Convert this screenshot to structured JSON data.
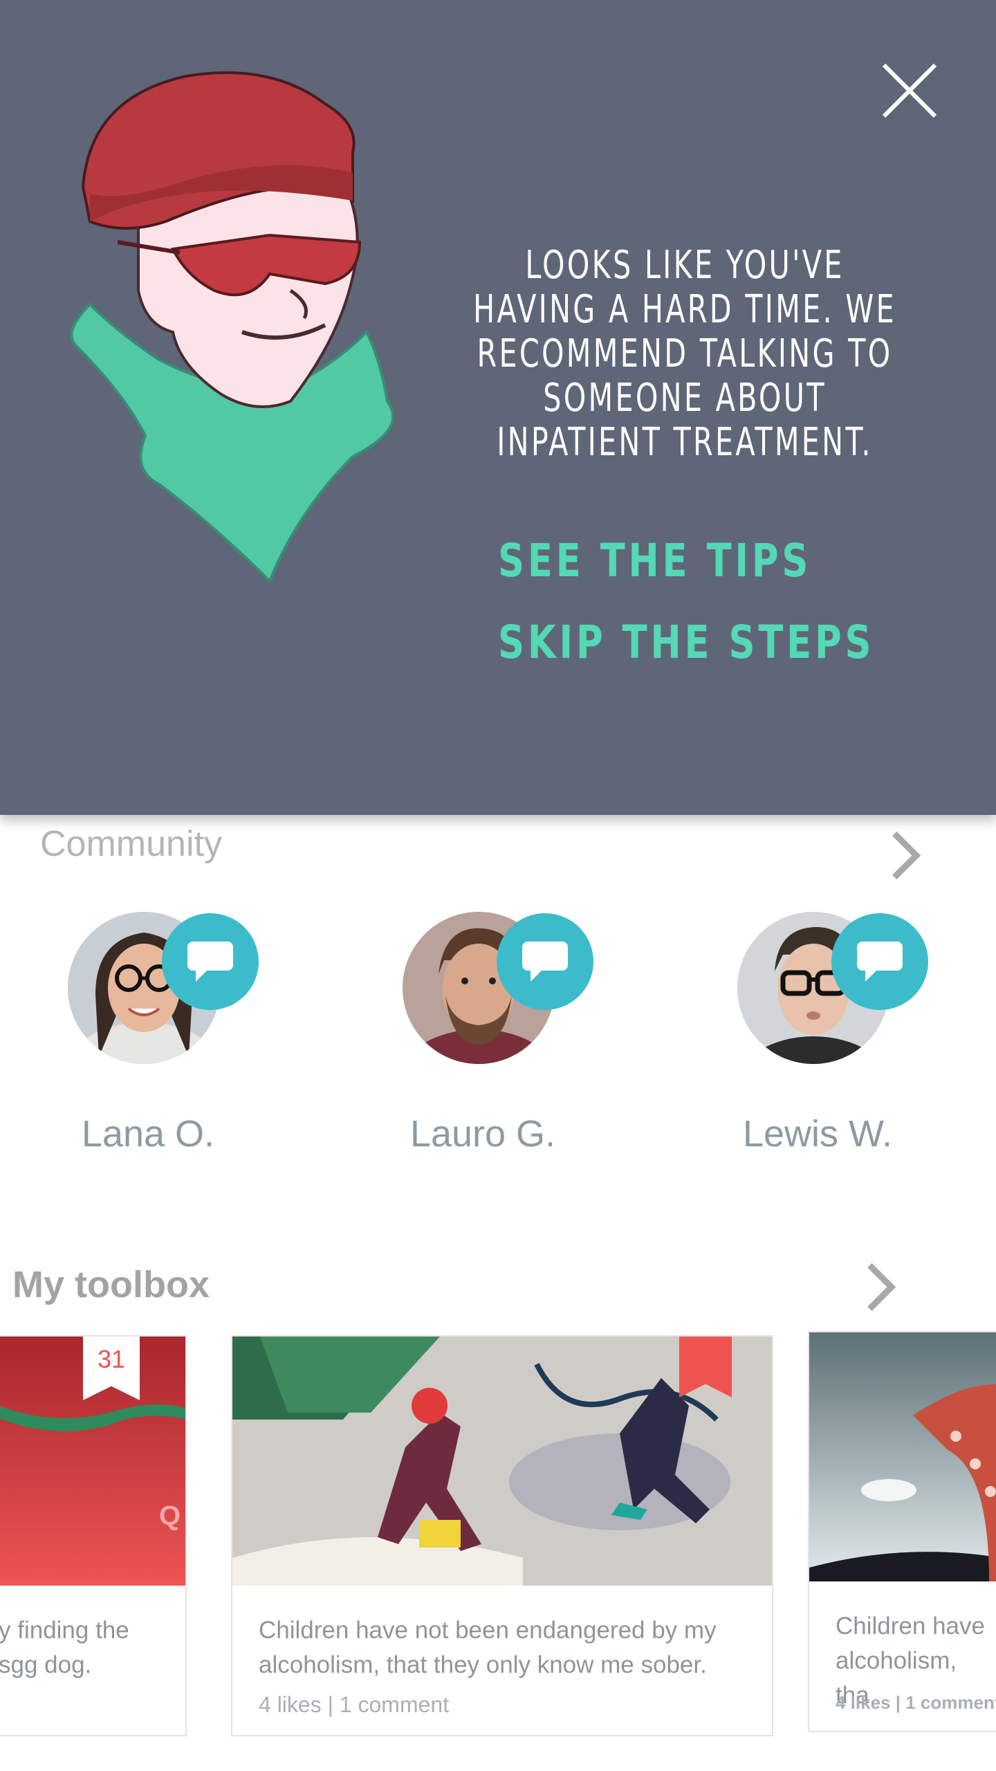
{
  "modal": {
    "message": "Looks like you've having a hard time. We recommend talking to someone about inpatient treatment.",
    "see_tips": "See the tips",
    "skip_steps": "Skip the steps"
  },
  "community": {
    "title": "Community",
    "members": [
      {
        "name": "Lana O."
      },
      {
        "name": "Lauro G."
      },
      {
        "name": "Lewis W."
      }
    ]
  },
  "toolbox": {
    "title": "My toolbox",
    "cards": [
      {
        "badge": "31",
        "text": "y finding the\nsgg dog."
      },
      {
        "text": "Children have not been endangered by my alcoholism, that they only know me sober.",
        "meta": "4 likes | 1 comment"
      },
      {
        "text": "Children have\nalcoholism, tha",
        "meta": "4 likes | 1 comment"
      }
    ]
  },
  "colors": {
    "modal_bg": "#5f6678",
    "link": "#53d9b5",
    "chat_badge": "#3cbccb",
    "bookmark": "#ef5350"
  }
}
